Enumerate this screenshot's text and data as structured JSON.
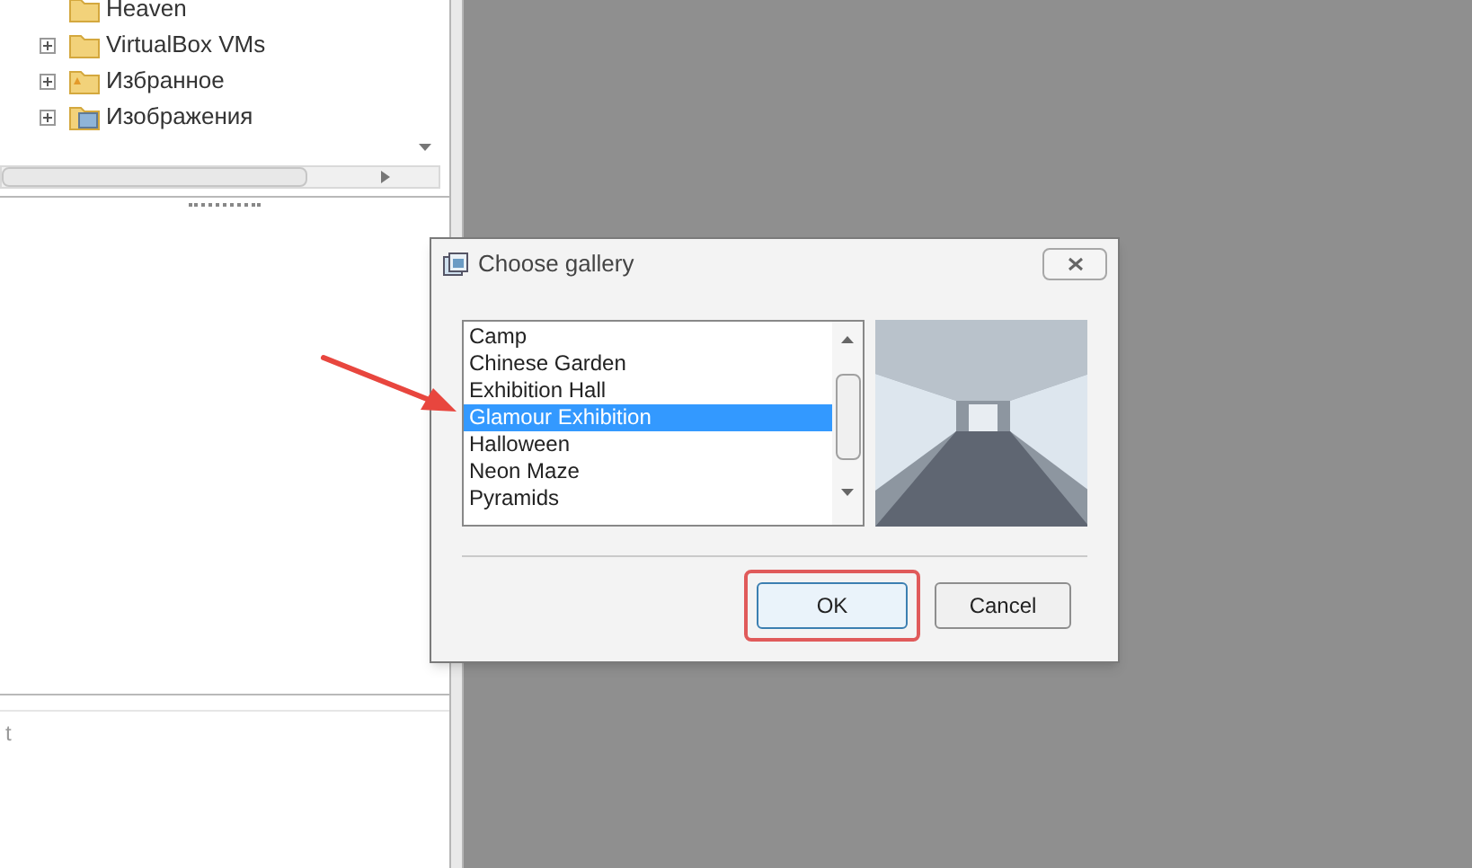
{
  "tree": {
    "items": [
      {
        "label": "Heaven",
        "expandable": false,
        "kind": "folder"
      },
      {
        "label": "VirtualBox VMs",
        "expandable": true,
        "kind": "folder"
      },
      {
        "label": "Избранное",
        "expandable": true,
        "kind": "favorites"
      },
      {
        "label": "Изображения",
        "expandable": true,
        "kind": "pictures"
      }
    ]
  },
  "lower_panel": {
    "label": "t"
  },
  "dialog": {
    "title": "Choose gallery",
    "galleries": [
      {
        "label": "Camp",
        "selected": false
      },
      {
        "label": "Chinese Garden",
        "selected": false
      },
      {
        "label": "Exhibition Hall",
        "selected": false
      },
      {
        "label": "Glamour Exhibition",
        "selected": true
      },
      {
        "label": "Halloween",
        "selected": false
      },
      {
        "label": "Neon Maze",
        "selected": false
      },
      {
        "label": "Pyramids",
        "selected": false
      }
    ],
    "buttons": [
      {
        "label": "OK",
        "highlighted": true,
        "default": true
      },
      {
        "label": "Cancel",
        "highlighted": false,
        "default": false
      }
    ]
  }
}
